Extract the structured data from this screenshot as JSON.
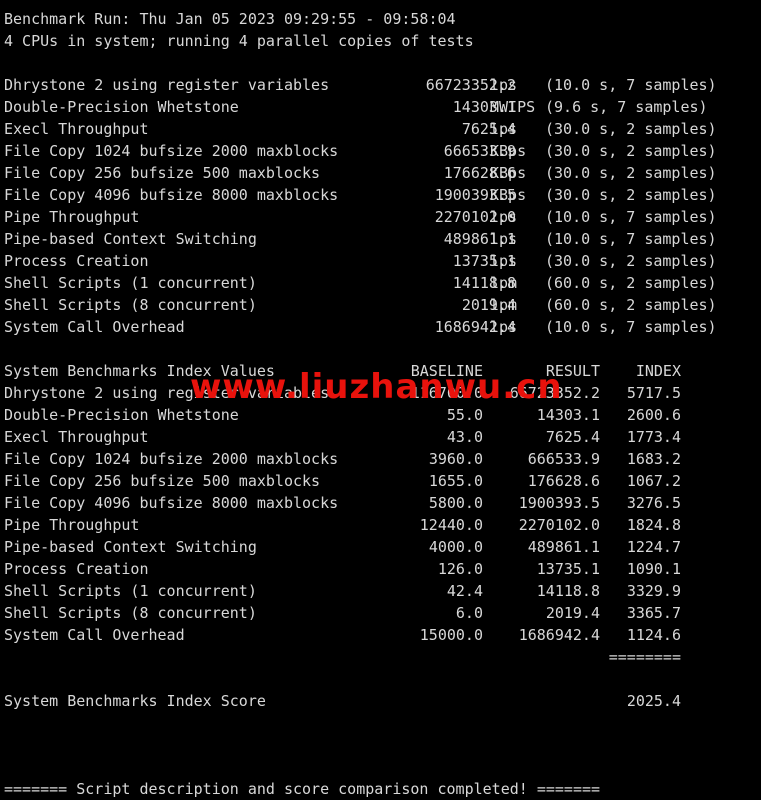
{
  "header": {
    "run_line": "Benchmark Run: Thu Jan 05 2023 09:29:55 - 09:58:04",
    "cpu_line": "4 CPUs in system; running 4 parallel copies of tests"
  },
  "raw_results": [
    {
      "name": "Dhrystone 2 using register variables",
      "value": "66723352.2",
      "unit": "lps",
      "samples": "(10.0 s, 7 samples)"
    },
    {
      "name": "Double-Precision Whetstone",
      "value": "14303.1",
      "unit": "MWIPS",
      "samples": "(9.6 s, 7 samples)"
    },
    {
      "name": "Execl Throughput",
      "value": "7625.4",
      "unit": "lps",
      "samples": "(30.0 s, 2 samples)"
    },
    {
      "name": "File Copy 1024 bufsize 2000 maxblocks",
      "value": "666533.9",
      "unit": "KBps",
      "samples": "(30.0 s, 2 samples)"
    },
    {
      "name": "File Copy 256 bufsize 500 maxblocks",
      "value": "176628.6",
      "unit": "KBps",
      "samples": "(30.0 s, 2 samples)"
    },
    {
      "name": "File Copy 4096 bufsize 8000 maxblocks",
      "value": "1900393.5",
      "unit": "KBps",
      "samples": "(30.0 s, 2 samples)"
    },
    {
      "name": "Pipe Throughput",
      "value": "2270102.0",
      "unit": "lps",
      "samples": "(10.0 s, 7 samples)"
    },
    {
      "name": "Pipe-based Context Switching",
      "value": "489861.1",
      "unit": "lps",
      "samples": "(10.0 s, 7 samples)"
    },
    {
      "name": "Process Creation",
      "value": "13735.1",
      "unit": "lps",
      "samples": "(30.0 s, 2 samples)"
    },
    {
      "name": "Shell Scripts (1 concurrent)",
      "value": "14118.8",
      "unit": "lpm",
      "samples": "(60.0 s, 2 samples)"
    },
    {
      "name": "Shell Scripts (8 concurrent)",
      "value": "2019.4",
      "unit": "lpm",
      "samples": "(60.0 s, 2 samples)"
    },
    {
      "name": "System Call Overhead",
      "value": "1686942.4",
      "unit": "lps",
      "samples": "(10.0 s, 7 samples)"
    }
  ],
  "index_table": {
    "title": "System Benchmarks Index Values",
    "col_baseline": "BASELINE",
    "col_result": "RESULT",
    "col_index": "INDEX",
    "rows": [
      {
        "name": "Dhrystone 2 using register variables",
        "baseline": "116700.0",
        "result": "66723352.2",
        "index": "5717.5"
      },
      {
        "name": "Double-Precision Whetstone",
        "baseline": "55.0",
        "result": "14303.1",
        "index": "2600.6"
      },
      {
        "name": "Execl Throughput",
        "baseline": "43.0",
        "result": "7625.4",
        "index": "1773.4"
      },
      {
        "name": "File Copy 1024 bufsize 2000 maxblocks",
        "baseline": "3960.0",
        "result": "666533.9",
        "index": "1683.2"
      },
      {
        "name": "File Copy 256 bufsize 500 maxblocks",
        "baseline": "1655.0",
        "result": "176628.6",
        "index": "1067.2"
      },
      {
        "name": "File Copy 4096 bufsize 8000 maxblocks",
        "baseline": "5800.0",
        "result": "1900393.5",
        "index": "3276.5"
      },
      {
        "name": "Pipe Throughput",
        "baseline": "12440.0",
        "result": "2270102.0",
        "index": "1824.8"
      },
      {
        "name": "Pipe-based Context Switching",
        "baseline": "4000.0",
        "result": "489861.1",
        "index": "1224.7"
      },
      {
        "name": "Process Creation",
        "baseline": "126.0",
        "result": "13735.1",
        "index": "1090.1"
      },
      {
        "name": "Shell Scripts (1 concurrent)",
        "baseline": "42.4",
        "result": "14118.8",
        "index": "3329.9"
      },
      {
        "name": "Shell Scripts (8 concurrent)",
        "baseline": "6.0",
        "result": "2019.4",
        "index": "3365.7"
      },
      {
        "name": "System Call Overhead",
        "baseline": "15000.0",
        "result": "1686942.4",
        "index": "1124.6"
      }
    ],
    "separator": "========",
    "score_label": "System Benchmarks Index Score",
    "score_value": "2025.4"
  },
  "footer": {
    "completed_line": "======= Script description and score comparison completed! ======="
  },
  "watermark": {
    "text": "www.liuzhanwu.cn",
    "color": "#e8120c"
  },
  "colors": {
    "background": "#000000",
    "text": "#d8d8d8"
  }
}
